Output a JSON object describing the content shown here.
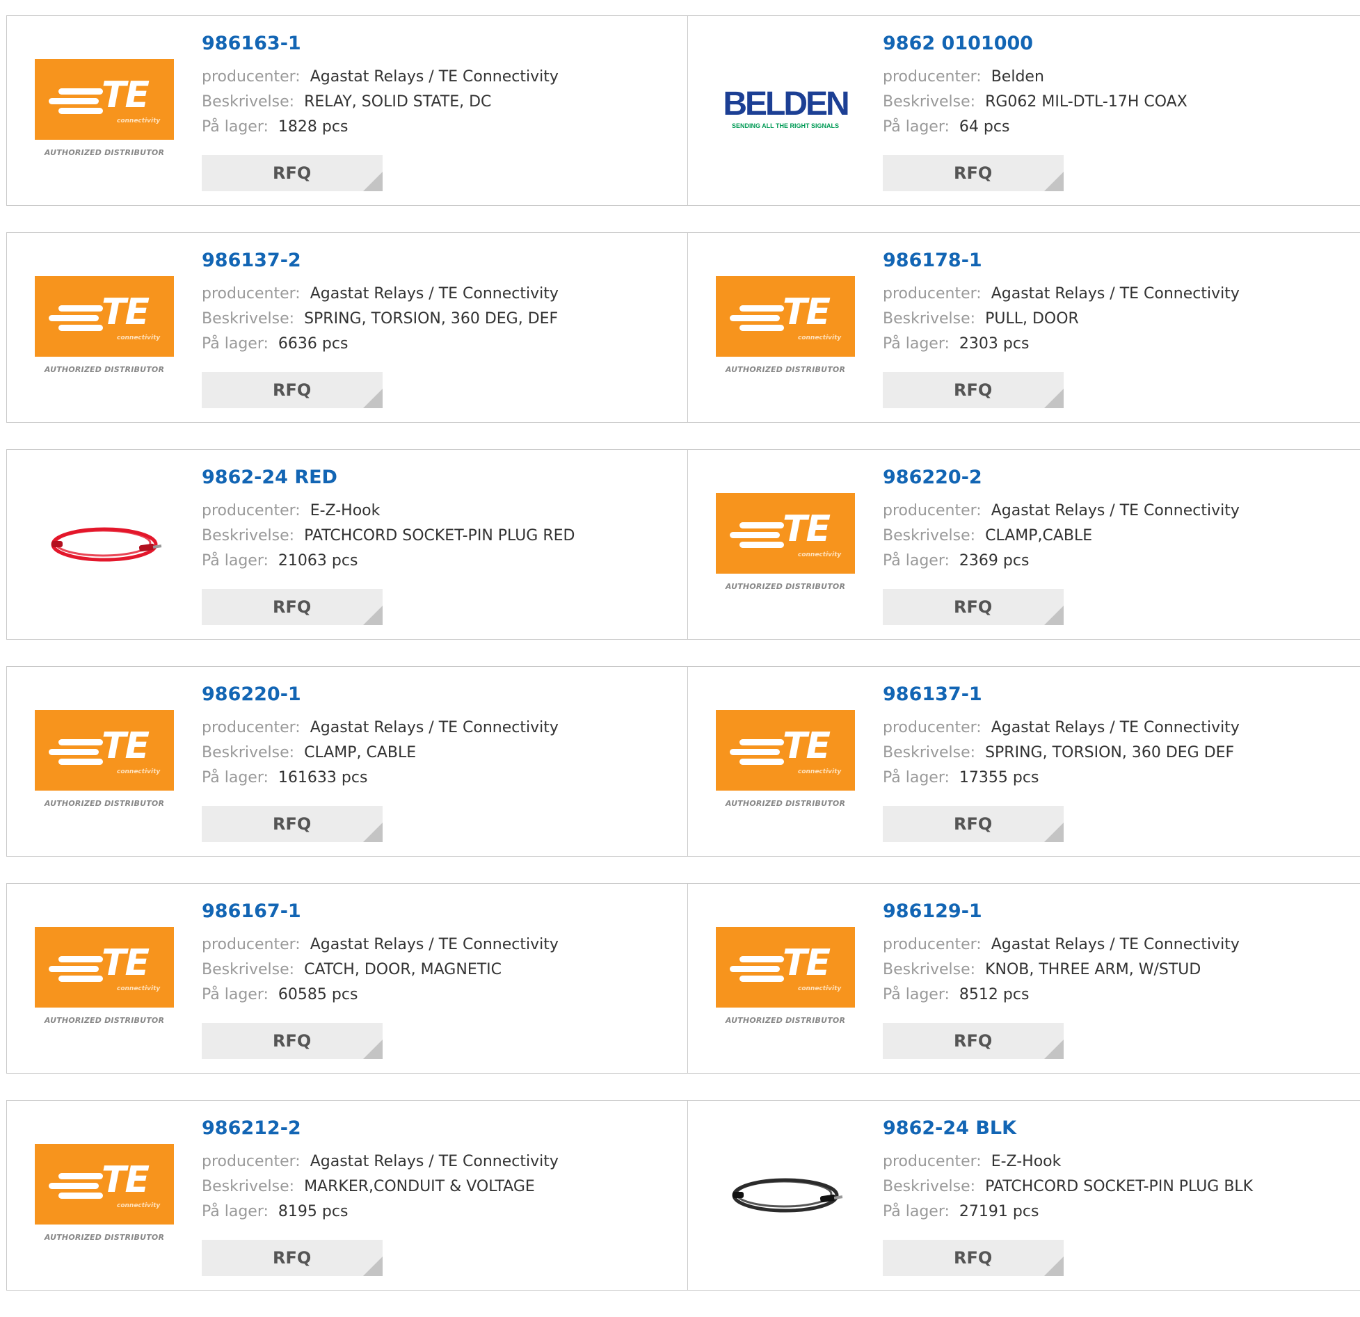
{
  "labels": {
    "manufacturer": "producenter:",
    "description": "Beskrivelse:",
    "stock": "På lager:",
    "rfq": "RFQ"
  },
  "logos": {
    "te": {
      "letters": "TE",
      "sub": "connectivity",
      "distributor": "AUTHORIZED DISTRIBUTOR",
      "color": "#f7941d"
    },
    "belden": {
      "word": "BELDEN",
      "tagline": "SENDING ALL THE RIGHT SIGNALS",
      "color": "#1c3f94"
    }
  },
  "products": [
    {
      "part": "986163-1",
      "manufacturer": "Agastat Relays / TE Connectivity",
      "description": "RELAY, SOLID STATE, DC",
      "stock": "1828 pcs",
      "image": "te-logo"
    },
    {
      "part": "9862 0101000",
      "manufacturer": "Belden",
      "description": "RG062 MIL-DTL-17H COAX",
      "stock": "64 pcs",
      "image": "belden-logo"
    },
    {
      "part": "986137-2",
      "manufacturer": "Agastat Relays / TE Connectivity",
      "description": "SPRING, TORSION, 360 DEG, DEF",
      "stock": "6636 pcs",
      "image": "te-logo"
    },
    {
      "part": "986178-1",
      "manufacturer": "Agastat Relays / TE Connectivity",
      "description": "PULL, DOOR",
      "stock": "2303 pcs",
      "image": "te-logo"
    },
    {
      "part": "9862-24 RED",
      "manufacturer": "E-Z-Hook",
      "description": "PATCHCORD SOCKET-PIN PLUG RED",
      "stock": "21063 pcs",
      "image": "red-cable"
    },
    {
      "part": "986220-2",
      "manufacturer": "Agastat Relays / TE Connectivity",
      "description": "CLAMP,CABLE",
      "stock": "2369 pcs",
      "image": "te-logo"
    },
    {
      "part": "986220-1",
      "manufacturer": "Agastat Relays / TE Connectivity",
      "description": "CLAMP, CABLE",
      "stock": "161633 pcs",
      "image": "te-logo"
    },
    {
      "part": "986137-1",
      "manufacturer": "Agastat Relays / TE Connectivity",
      "description": "SPRING, TORSION, 360 DEG DEF",
      "stock": "17355 pcs",
      "image": "te-logo"
    },
    {
      "part": "986167-1",
      "manufacturer": "Agastat Relays / TE Connectivity",
      "description": "CATCH, DOOR, MAGNETIC",
      "stock": "60585 pcs",
      "image": "te-logo"
    },
    {
      "part": "986129-1",
      "manufacturer": "Agastat Relays / TE Connectivity",
      "description": "KNOB, THREE ARM, W/STUD",
      "stock": "8512 pcs",
      "image": "te-logo"
    },
    {
      "part": "986212-2",
      "manufacturer": "Agastat Relays / TE Connectivity",
      "description": "MARKER,CONDUIT & VOLTAGE",
      "stock": "8195 pcs",
      "image": "te-logo"
    },
    {
      "part": "9862-24 BLK",
      "manufacturer": "E-Z-Hook",
      "description": "PATCHCORD SOCKET-PIN PLUG BLK",
      "stock": "27191 pcs",
      "image": "black-cable"
    }
  ]
}
